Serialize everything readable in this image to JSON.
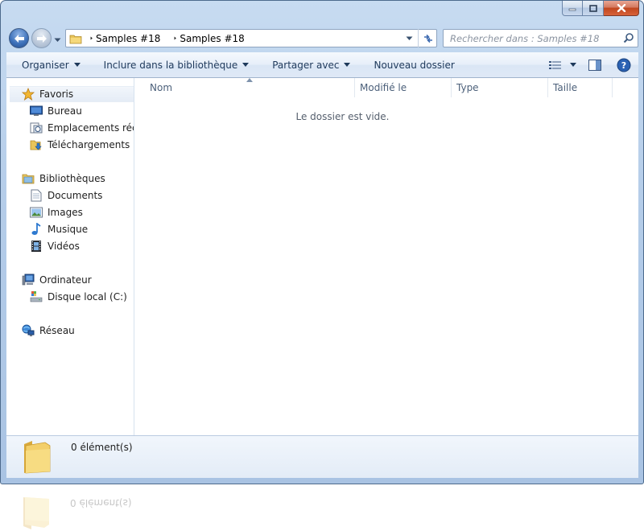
{
  "window": {
    "title": ""
  },
  "address": {
    "crumbs": [
      "Samples #18",
      "Samples #18"
    ]
  },
  "search": {
    "placeholder": "Rechercher dans : Samples #18"
  },
  "toolbar": {
    "organize": "Organiser",
    "include_library": "Inclure dans la bibliothèque",
    "share_with": "Partager avec",
    "new_folder": "Nouveau dossier"
  },
  "sidebar": {
    "favorites": {
      "label": "Favoris",
      "items": [
        "Bureau",
        "Emplacements récents",
        "Téléchargements"
      ]
    },
    "libraries": {
      "label": "Bibliothèques",
      "items": [
        "Documents",
        "Images",
        "Musique",
        "Vidéos"
      ]
    },
    "computer": {
      "label": "Ordinateur",
      "items": [
        "Disque local (C:)"
      ]
    },
    "network": {
      "label": "Réseau"
    }
  },
  "columns": [
    "Nom",
    "Modifié le",
    "Type",
    "Taille"
  ],
  "content": {
    "empty_message": "Le dossier est vide."
  },
  "details": {
    "count_text": "0 élément(s)"
  },
  "colors": {
    "frame": "#b5cde9",
    "command_bar": "#dfe9f6",
    "close_button": "#c0461f"
  }
}
